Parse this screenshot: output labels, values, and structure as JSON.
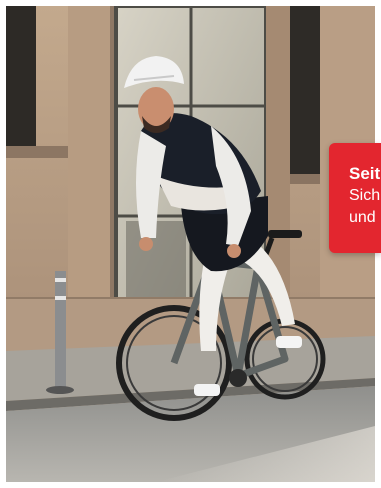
{
  "promo": {
    "title": "Seit",
    "line1": "Sich",
    "line2": "und"
  },
  "colors": {
    "accent": "#e3262f",
    "background": "#ffffff"
  },
  "photo": {
    "subject": "cyclist-on-road-bike"
  }
}
